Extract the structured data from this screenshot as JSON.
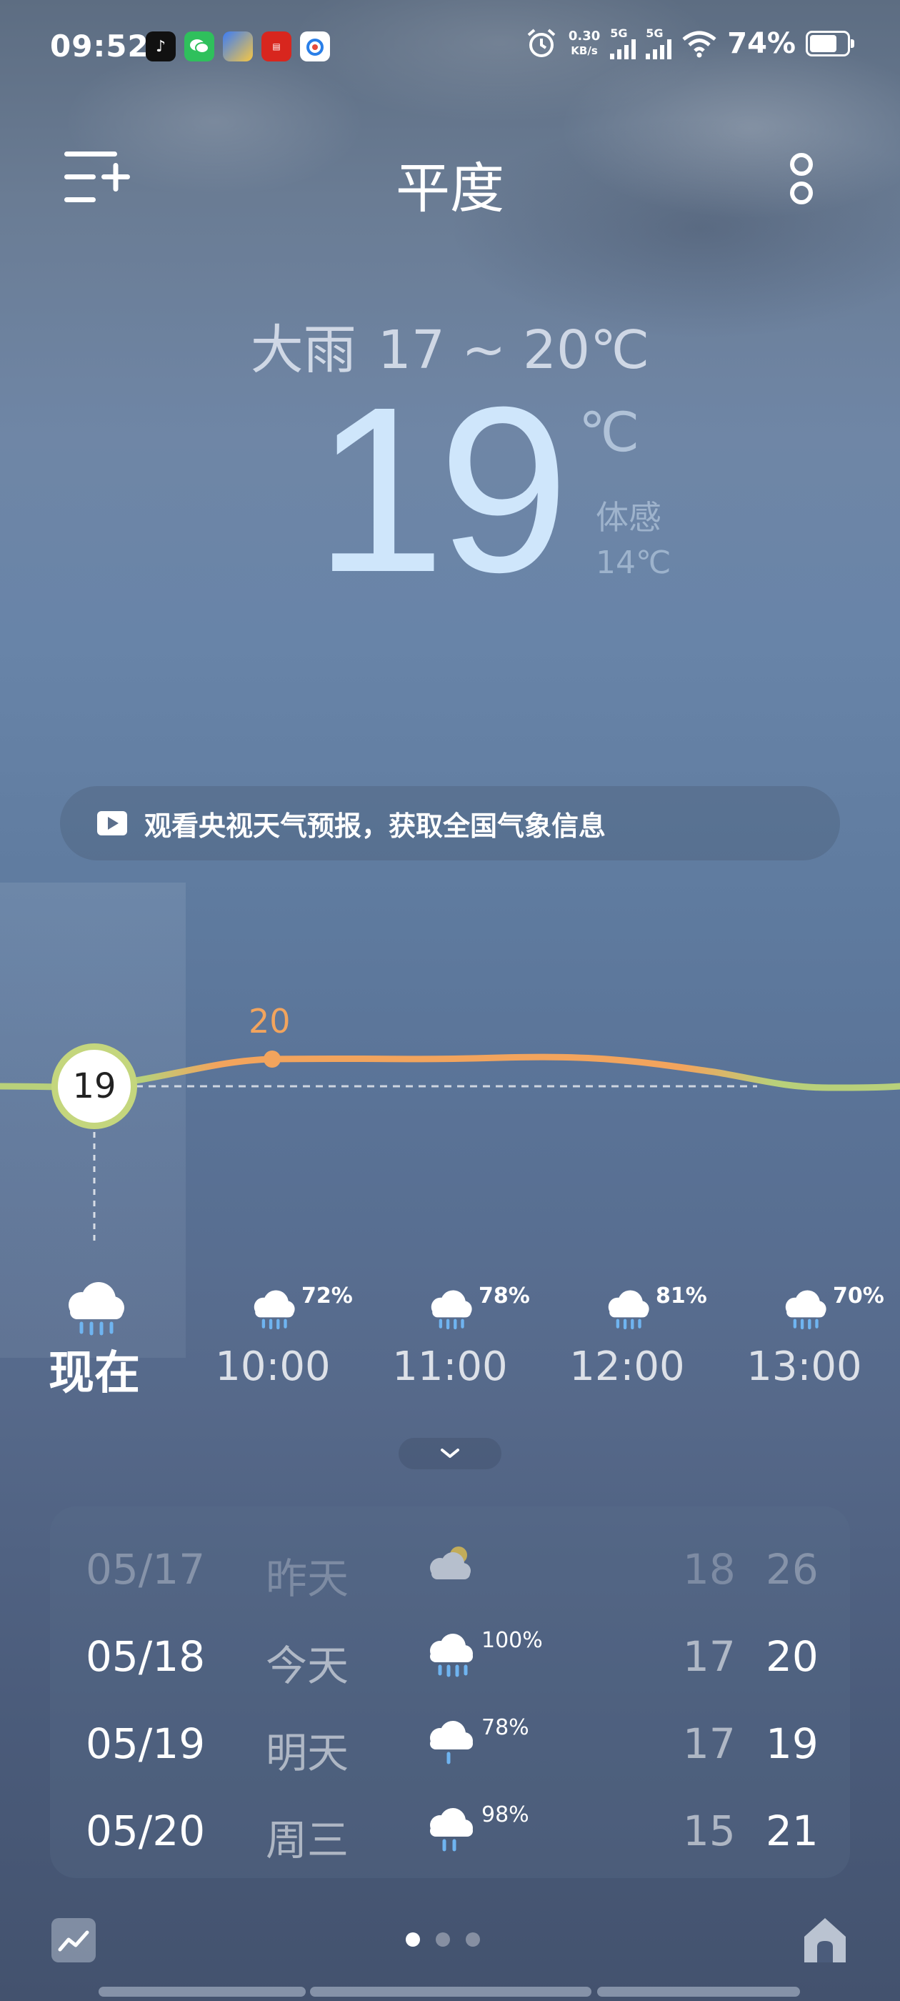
{
  "status_bar": {
    "time": "09:52",
    "apps": [
      "tiktok-icon",
      "wechat-icon",
      "browser-icon",
      "news-app-icon",
      "weibo-icon"
    ],
    "net_speed_value": "0.30",
    "net_speed_unit": "KB/s",
    "sim1_label": "5G",
    "sim2_label": "5G",
    "battery_percent": "74%",
    "battery_level": 0.74
  },
  "header": {
    "city": "平度"
  },
  "current": {
    "condition": "大雨",
    "range": "17 ~ 20℃",
    "temperature": "19",
    "unit": "℃",
    "feels_like_label": "体感",
    "feels_like_value": "14℃"
  },
  "banner": {
    "text": "观看央视天气预报，获取全国气象信息"
  },
  "hourly": {
    "peak_label": "20",
    "now_value": "19",
    "items": [
      {
        "time": "现在",
        "precip": "",
        "icon": "rain-cloud-icon"
      },
      {
        "time": "10:00",
        "precip": "72%",
        "icon": "rain-cloud-icon"
      },
      {
        "time": "11:00",
        "precip": "78%",
        "icon": "rain-cloud-icon"
      },
      {
        "time": "12:00",
        "precip": "81%",
        "icon": "rain-cloud-icon"
      },
      {
        "time": "13:00",
        "precip": "70%",
        "icon": "rain-cloud-icon"
      }
    ]
  },
  "daily": [
    {
      "date": "05/17",
      "day": "昨天",
      "icon": "partly-cloudy-icon",
      "precip": "",
      "low": "18",
      "high": "26"
    },
    {
      "date": "05/18",
      "day": "今天",
      "icon": "rain-cloud-icon",
      "precip": "100%",
      "low": "17",
      "high": "20"
    },
    {
      "date": "05/19",
      "day": "明天",
      "icon": "rain-cloud-icon",
      "precip": "78%",
      "low": "17",
      "high": "19"
    },
    {
      "date": "05/20",
      "day": "周三",
      "icon": "rain-cloud-icon",
      "precip": "98%",
      "low": "15",
      "high": "21"
    }
  ],
  "pager": {
    "count": 3,
    "active": 0
  },
  "colors": {
    "temp_curve_warm": "#f2a45d",
    "temp_curve_mild": "#b8d07a",
    "big_temp": "#cfe6fb"
  }
}
